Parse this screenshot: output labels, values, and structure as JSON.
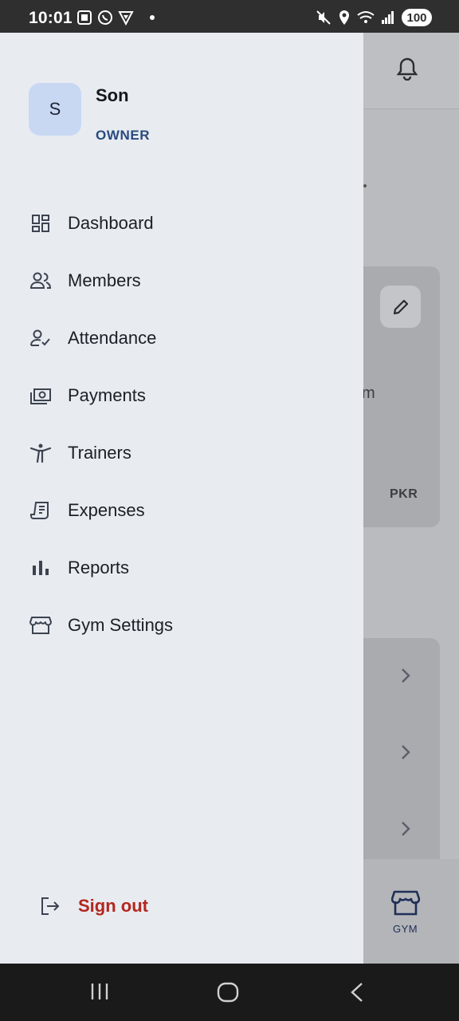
{
  "status_bar": {
    "time": "10:01",
    "battery": "100",
    "left_icons": [
      "screenshot-icon",
      "whatsapp-icon",
      "vpn-shield-icon",
      "dot-icon"
    ],
    "right_icons": [
      "mute-icon",
      "location-icon",
      "wifi-icon",
      "signal-icon"
    ]
  },
  "drawer": {
    "avatar_initial": "S",
    "user_name": "Son",
    "user_role": "OWNER",
    "menu": [
      {
        "label": "Dashboard",
        "icon": "dashboard-icon"
      },
      {
        "label": "Members",
        "icon": "members-icon"
      },
      {
        "label": "Attendance",
        "icon": "attendance-icon"
      },
      {
        "label": "Payments",
        "icon": "payments-icon"
      },
      {
        "label": "Trainers",
        "icon": "trainers-icon"
      },
      {
        "label": "Expenses",
        "icon": "expenses-icon"
      },
      {
        "label": "Reports",
        "icon": "reports-icon"
      },
      {
        "label": "Gym Settings",
        "icon": "storefront-icon"
      }
    ],
    "sign_out": "Sign out"
  },
  "background_app": {
    "fragment_text": "m",
    "currency": "PKR",
    "bottom_nav_label": "GYM"
  },
  "colors": {
    "drawer_bg": "#e8ebf0",
    "avatar_bg": "#c8d8f3",
    "role_text": "#284a80",
    "sign_out": "#b3261e",
    "scrim": "#b9bbbe"
  }
}
